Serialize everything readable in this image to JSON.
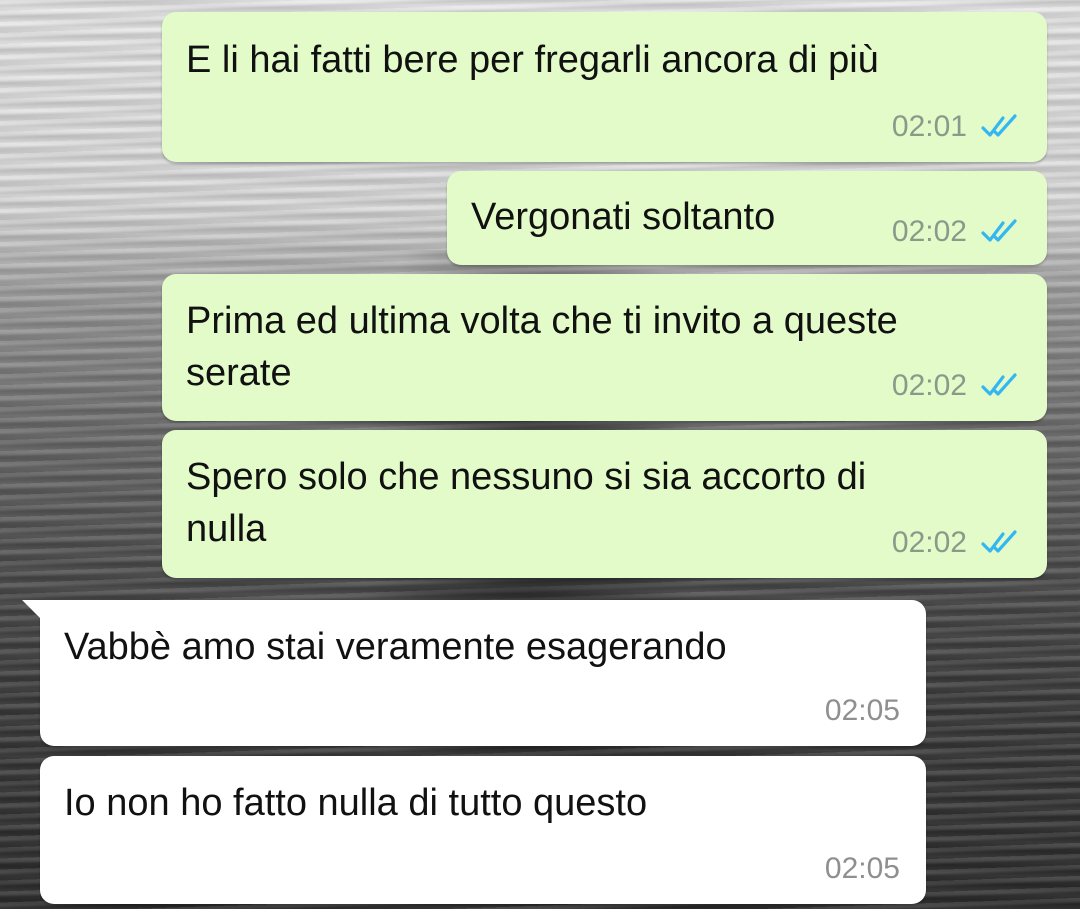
{
  "chat": {
    "messages": [
      {
        "direction": "outgoing",
        "text": "E li hai fatti bere per fregarli ancora di più",
        "time": "02:01",
        "status": "read"
      },
      {
        "direction": "outgoing",
        "text": "Vergonati soltanto",
        "time": "02:02",
        "status": "read"
      },
      {
        "direction": "outgoing",
        "line1": "Prima ed ultima volta che ti invito a queste",
        "line2": "serate",
        "time": "02:02",
        "status": "read"
      },
      {
        "direction": "outgoing",
        "line1": "Spero solo che nessuno si sia accorto di",
        "line2": "nulla",
        "time": "02:02",
        "status": "read"
      },
      {
        "direction": "incoming",
        "text": "Vabbè amo stai veramente esagerando",
        "time": "02:05"
      },
      {
        "direction": "incoming",
        "text": "Io non ho fatto nulla di tutto questo",
        "time": "02:05"
      }
    ]
  },
  "colors": {
    "outgoing_bubble": "#e2fbc9",
    "incoming_bubble": "#ffffff",
    "read_tick": "#34b7f1",
    "timestamp": "#8a9a8a"
  },
  "icons": {
    "read_status": "double-check-icon"
  }
}
